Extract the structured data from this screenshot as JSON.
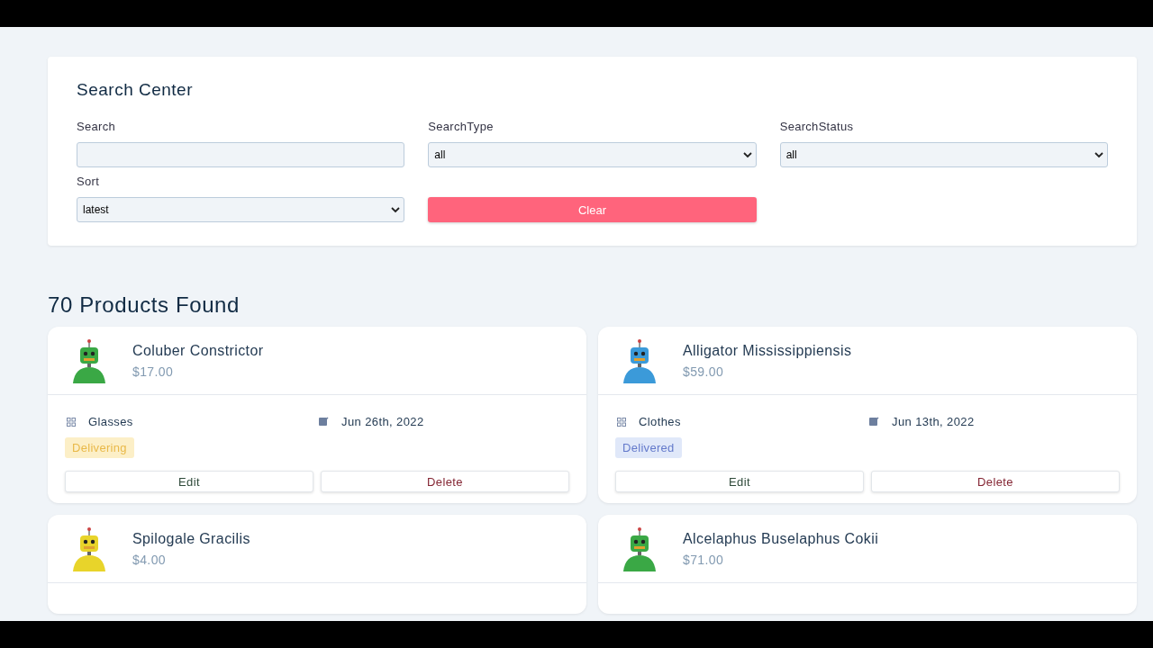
{
  "search_center": {
    "title": "Search Center",
    "fields": [
      {
        "label": "Search",
        "kind": "text"
      },
      {
        "label": "SearchType",
        "kind": "select",
        "value": "all"
      },
      {
        "label": "SearchStatus",
        "kind": "select",
        "value": "all"
      },
      {
        "label": "Sort",
        "kind": "select",
        "value": "latest"
      }
    ],
    "clear_button": "Clear"
  },
  "results_heading": "70 Products Found",
  "products": [
    {
      "name": "Coluber Constrictor",
      "price": "$17.00",
      "color": "#3aa845",
      "category": "Glasses",
      "date": "Jun 26th, 2022",
      "status": {
        "label": "Delivering",
        "kind": "delivering"
      },
      "edit": "Edit",
      "delete": "Delete"
    },
    {
      "name": "Alligator Mississippiensis",
      "price": "$59.00",
      "color": "#3b9ad9",
      "category": "Clothes",
      "date": "Jun 13th, 2022",
      "status": {
        "label": "Delivered",
        "kind": "delivered"
      },
      "edit": "Edit",
      "delete": "Delete"
    },
    {
      "name": "Spilogale Gracilis",
      "price": "$4.00",
      "color": "#e8d42a"
    },
    {
      "name": "Alcelaphus Buselaphus Cokii",
      "price": "$71.00",
      "color": "#3aa845"
    }
  ]
}
